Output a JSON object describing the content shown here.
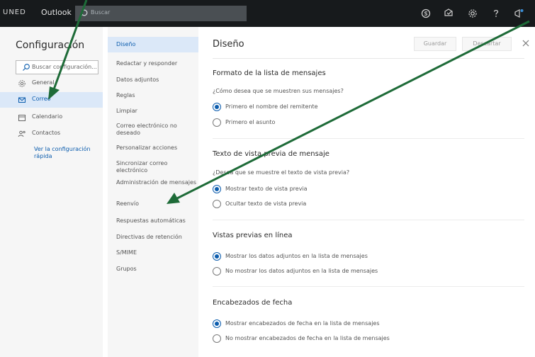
{
  "topbar": {
    "brand": "UNED",
    "app_name": "Outlook",
    "search_placeholder": "Buscar"
  },
  "left": {
    "title": "Configuración",
    "search_placeholder": "Buscar configuración...",
    "items": [
      {
        "label": "General",
        "icon": "gear-icon"
      },
      {
        "label": "Correo",
        "icon": "mail-icon"
      },
      {
        "label": "Calendario",
        "icon": "calendar-icon"
      },
      {
        "label": "Contactos",
        "icon": "contacts-icon"
      }
    ],
    "quick_settings": "Ver la configuración rápida"
  },
  "middle": {
    "items": [
      {
        "label": "Diseño"
      },
      {
        "label": "Redactar y responder"
      },
      {
        "label": "Datos adjuntos"
      },
      {
        "label": "Reglas"
      },
      {
        "label": "Limpiar"
      },
      {
        "label": "Correo electrónico no deseado"
      },
      {
        "label": "Personalizar acciones"
      },
      {
        "label": "Sincronizar correo electrónico"
      },
      {
        "label": "Administración de mensajes"
      },
      {
        "label": "Reenvío"
      },
      {
        "label": "Respuestas automáticas"
      },
      {
        "label": "Directivas de retención"
      },
      {
        "label": "S/MIME"
      },
      {
        "label": "Grupos"
      }
    ]
  },
  "main": {
    "title": "Diseño",
    "save_label": "Guardar",
    "discard_label": "Descartar",
    "sections": [
      {
        "title": "Formato de la lista de mensajes",
        "question": "¿Cómo desea que se muestren sus mensajes?",
        "options": [
          {
            "label": "Primero el nombre del remitente",
            "selected": true
          },
          {
            "label": "Primero el asunto",
            "selected": false
          }
        ]
      },
      {
        "title": "Texto de vista previa de mensaje",
        "question": "¿Desea que se muestre el texto de vista previa?",
        "options": [
          {
            "label": "Mostrar texto de vista previa",
            "selected": true
          },
          {
            "label": "Ocultar texto de vista previa",
            "selected": false
          }
        ]
      },
      {
        "title": "Vistas previas en línea",
        "question": "",
        "options": [
          {
            "label": "Mostrar los datos adjuntos en la lista de mensajes",
            "selected": true
          },
          {
            "label": "No mostrar los datos adjuntos en la lista de mensajes",
            "selected": false
          }
        ]
      },
      {
        "title": "Encabezados de fecha",
        "question": "",
        "options": [
          {
            "label": "Mostrar encabezados de fecha en la lista de mensajes",
            "selected": true
          },
          {
            "label": "No mostrar encabezados de fecha en la lista de mensajes",
            "selected": false
          }
        ]
      }
    ]
  },
  "colors": {
    "accent": "#0b5cad",
    "selection": "#dbe8f8",
    "topbar": "#171a1c",
    "annotation_arrow": "#1e6b38"
  }
}
